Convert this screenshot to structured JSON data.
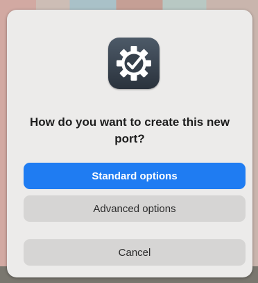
{
  "dialog": {
    "icon": "gear-checkmark-icon",
    "question": "How do you want to create this new port?",
    "buttons": {
      "standard_label": "Standard options",
      "advanced_label": "Advanced options",
      "cancel_label": "Cancel"
    }
  },
  "colors": {
    "accent": "#1f7cf2",
    "dialog_bg": "#ecebea",
    "secondary_button": "#d6d5d4"
  }
}
